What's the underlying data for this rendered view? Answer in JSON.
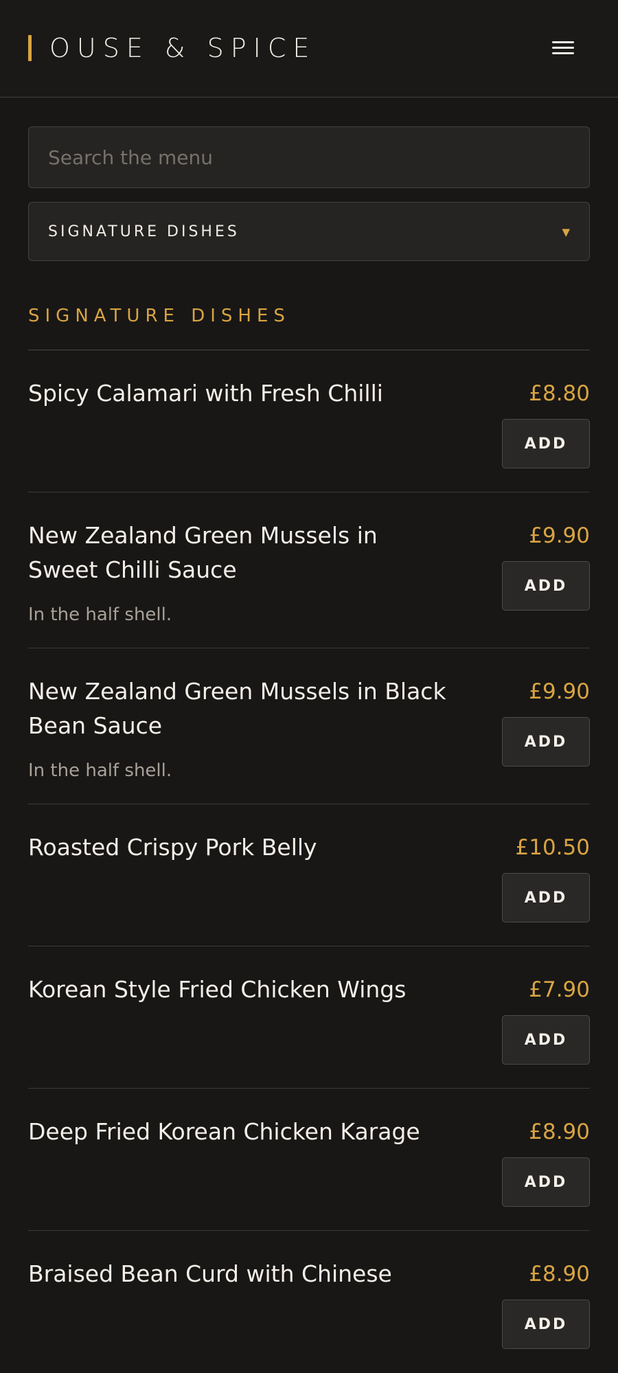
{
  "header": {
    "brand": "OUSE & SPICE"
  },
  "search": {
    "placeholder": "Search the menu"
  },
  "category_select": {
    "selected": "SIGNATURE DISHES"
  },
  "section": {
    "title": "SIGNATURE DISHES"
  },
  "items": [
    {
      "name": "Spicy Calamari with Fresh Chilli",
      "price": "£8.80",
      "desc": "",
      "add_label": "ADD"
    },
    {
      "name": "New Zealand Green Mussels in Sweet Chilli Sauce",
      "price": "£9.90",
      "desc": "In the half shell.",
      "add_label": "ADD"
    },
    {
      "name": "New Zealand Green Mussels in Black Bean Sauce",
      "price": "£9.90",
      "desc": "In the half shell.",
      "add_label": "ADD"
    },
    {
      "name": "Roasted Crispy Pork Belly",
      "price": "£10.50",
      "desc": "",
      "add_label": "ADD"
    },
    {
      "name": "Korean Style Fried Chicken Wings",
      "price": "£7.90",
      "desc": "",
      "add_label": "ADD"
    },
    {
      "name": "Deep Fried Korean Chicken Karage",
      "price": "£8.90",
      "desc": "",
      "add_label": "ADD"
    },
    {
      "name": "Braised Bean Curd with Chinese",
      "price": "£8.90",
      "desc": "",
      "add_label": "ADD"
    }
  ],
  "colors": {
    "background": "#181716",
    "accent": "#d9a441",
    "text": "#f1ede6",
    "muted": "#a9a198"
  }
}
